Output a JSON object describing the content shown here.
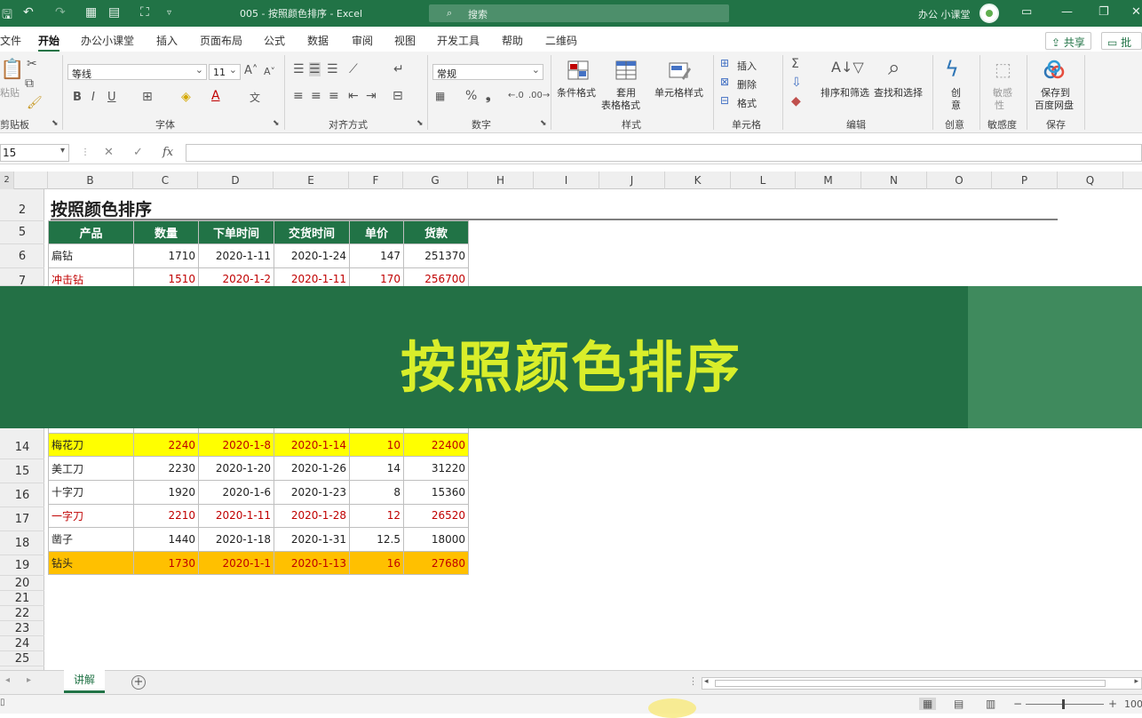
{
  "titlebar": {
    "doc_title": "005 - 按照颜色排序 - Excel",
    "search_placeholder": "搜索",
    "user_name": "办公 小课堂"
  },
  "menu": {
    "items": [
      "文件",
      "开始",
      "办公小课堂",
      "插入",
      "页面布局",
      "公式",
      "数据",
      "审阅",
      "视图",
      "开发工具",
      "帮助",
      "二维码"
    ],
    "active": "开始",
    "share": "共享",
    "comments": "批注"
  },
  "ribbon": {
    "clipboard": {
      "paste": "粘贴",
      "label": "剪贴板"
    },
    "font": {
      "name": "等线",
      "size": "11",
      "label": "字体"
    },
    "alignment": {
      "label": "对齐方式"
    },
    "number": {
      "format": "常规",
      "label": "数字"
    },
    "styles": {
      "conditional": "条件格式",
      "table_line1": "套用",
      "table_line2": "表格格式",
      "cell_styles": "单元格样式",
      "label": "样式"
    },
    "cells": {
      "insert": "插入",
      "delete": "删除",
      "format": "格式",
      "label": "单元格"
    },
    "editing": {
      "sort_filter": "排序和筛选",
      "find_select": "查找和选择",
      "label": "编辑"
    },
    "idea": {
      "line1": "创",
      "line2": "意",
      "label": "创意"
    },
    "sensitivity": {
      "line1": "敏感",
      "line2": "性",
      "label": "敏感度"
    },
    "save": {
      "line1": "保存到",
      "line2": "百度网盘",
      "label": "保存"
    }
  },
  "formula_bar": {
    "name_box": "15",
    "fx": "fx"
  },
  "grid": {
    "columns": [
      "B",
      "C",
      "D",
      "E",
      "F",
      "G",
      "H",
      "I",
      "J",
      "K",
      "L",
      "M",
      "N",
      "O",
      "P",
      "Q"
    ],
    "rows": [
      "2",
      "5",
      "6",
      "7",
      "14",
      "15",
      "16",
      "17",
      "18",
      "19",
      "20",
      "21",
      "22",
      "23",
      "24",
      "25"
    ],
    "top_left_row": "2"
  },
  "sheet": {
    "title": "按照颜色排序",
    "headers": [
      "产品",
      "数量",
      "下单时间",
      "交货时间",
      "单价",
      "货款"
    ],
    "rows": [
      {
        "row": "6",
        "cells": [
          "扁钻",
          "1710",
          "2020-1-11",
          "2020-1-24",
          "147",
          "251370"
        ],
        "style": "normal"
      },
      {
        "row": "7",
        "cells": [
          "冲击钻",
          "1510",
          "2020-1-2",
          "2020-1-11",
          "170",
          "256700"
        ],
        "style": "red"
      },
      {
        "row": "14",
        "cells": [
          "梅花刀",
          "2240",
          "2020-1-8",
          "2020-1-14",
          "10",
          "22400"
        ],
        "style": "yellow"
      },
      {
        "row": "15",
        "cells": [
          "美工刀",
          "2230",
          "2020-1-20",
          "2020-1-26",
          "14",
          "31220"
        ],
        "style": "normal"
      },
      {
        "row": "16",
        "cells": [
          "十字刀",
          "1920",
          "2020-1-6",
          "2020-1-23",
          "8",
          "15360"
        ],
        "style": "normal"
      },
      {
        "row": "17",
        "cells": [
          "一字刀",
          "2210",
          "2020-1-11",
          "2020-1-28",
          "12",
          "26520"
        ],
        "style": "red"
      },
      {
        "row": "18",
        "cells": [
          "凿子",
          "1440",
          "2020-1-18",
          "2020-1-31",
          "12.5",
          "18000"
        ],
        "style": "normal"
      },
      {
        "row": "19",
        "cells": [
          "钻头",
          "1730",
          "2020-1-1",
          "2020-1-13",
          "16",
          "27680"
        ],
        "style": "orange"
      }
    ],
    "colors": {
      "header_bg": "#217346",
      "yellow": "#ffff00",
      "orange": "#ffc000",
      "red_text": "#c00000"
    }
  },
  "banner": {
    "text": "按照颜色排序",
    "bg": "#237045",
    "text_color": "#d9ee2a"
  },
  "tabs": {
    "sheets": [
      "讲解"
    ],
    "add": "+"
  },
  "status": {
    "zoom": "100"
  }
}
